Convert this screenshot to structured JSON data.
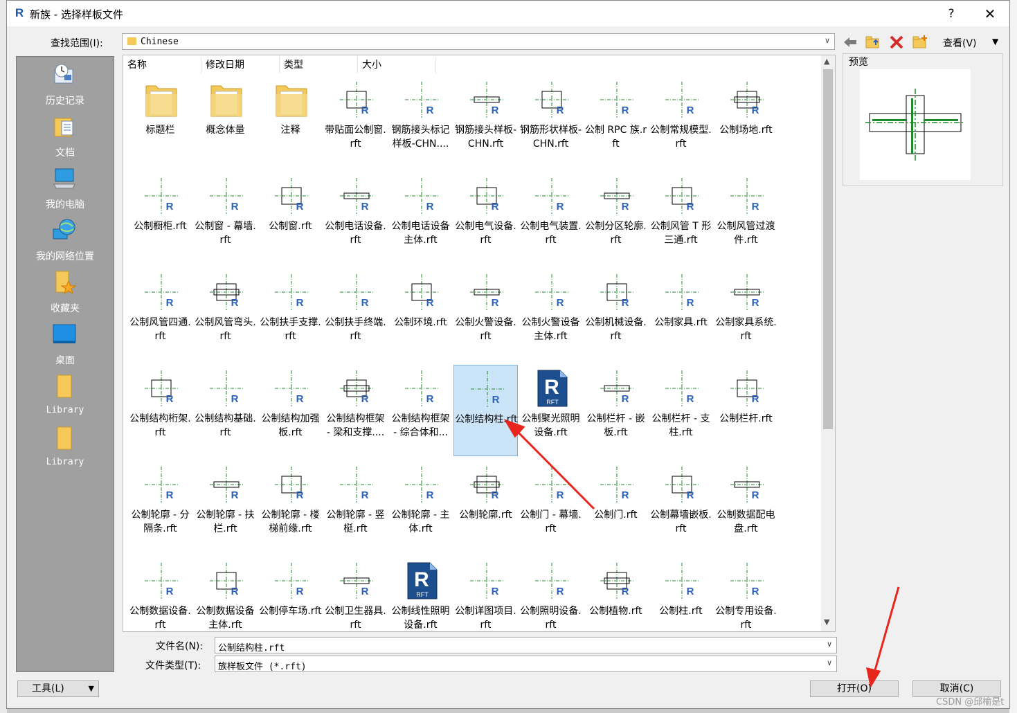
{
  "window": {
    "title": "新族 - 选择样板文件",
    "help": "?",
    "close": "✕"
  },
  "lookin": {
    "label": "查找范围(I):",
    "value": "Chinese"
  },
  "toolbar": {
    "view_label": "查看(V)"
  },
  "places": [
    {
      "label": "历史记录"
    },
    {
      "label": "文档"
    },
    {
      "label": "我的电脑"
    },
    {
      "label": "我的网络位置"
    },
    {
      "label": "收藏夹"
    },
    {
      "label": "桌面"
    },
    {
      "label": "Library"
    },
    {
      "label": "Library"
    }
  ],
  "columns": [
    "名称",
    "修改日期",
    "类型",
    "大小"
  ],
  "items": [
    "标题栏",
    "概念体量",
    "注释",
    "带贴面公制窗.rft",
    "钢筋接头标记样板-CHN....",
    "钢筋接头样板-CHN.rft",
    "钢筋形状样板-CHN.rft",
    "公制 RPC 族.rft",
    "公制常规模型.rft",
    "公制场地.rft",
    "公制橱柜.rft",
    "公制窗 - 幕墙.rft",
    "公制窗.rft",
    "公制电话设备.rft",
    "公制电话设备主体.rft",
    "公制电气设备.rft",
    "公制电气装置.rft",
    "公制分区轮廓.rft",
    "公制风管 T 形三通.rft",
    "公制风管过渡件.rft",
    "公制风管四通.rft",
    "公制风管弯头.rft",
    "公制扶手支撑.rft",
    "公制扶手终端.rft",
    "公制环境.rft",
    "公制火警设备.rft",
    "公制火警设备主体.rft",
    "公制机械设备.rft",
    "公制家具.rft",
    "公制家具系统.rft",
    "公制结构桁架.rft",
    "公制结构基础.rft",
    "公制结构加强板.rft",
    "公制结构框架 - 梁和支撑....",
    "公制结构框架 - 综合体和...",
    "公制结构柱.rft",
    "公制聚光照明设备.rft",
    "公制栏杆 - 嵌板.rft",
    "公制栏杆 - 支柱.rft",
    "公制栏杆.rft",
    "公制轮廓 - 分隔条.rft",
    "公制轮廓 - 扶栏.rft",
    "公制轮廓 - 楼梯前缘.rft",
    "公制轮廓 - 竖梃.rft",
    "公制轮廓 - 主体.rft",
    "公制轮廓.rft",
    "公制门 - 幕墙.rft",
    "公制门.rft",
    "公制幕墙嵌板.rft",
    "公制数据配电盘.rft",
    "公制数据设备.rft",
    "公制数据设备主体.rft",
    "公制停车场.rft",
    "公制卫生器具.rft",
    "公制线性照明设备.rft",
    "公制详图项目.rft",
    "公制照明设备.rft",
    "公制植物.rft",
    "公制柱.rft",
    "公制专用设备.rft"
  ],
  "selected_index": 35,
  "big_rft_badge": "RFT",
  "preview": {
    "label": "预览"
  },
  "filename": {
    "label": "文件名(N):",
    "value": "公制结构柱.rft"
  },
  "filetype": {
    "label": "文件类型(T):",
    "value": "族样板文件 (*.rft)"
  },
  "buttons": {
    "tools": "工具(L)",
    "open": "打开(O)",
    "cancel": "取消(C)"
  },
  "watermark": "CSDN @邱榆是t",
  "colors": {
    "selection": "#cce4f7",
    "arrow": "#e8261c",
    "revit_blue": "#2a62b9",
    "folder": "#f4c95a",
    "cad_green": "#1e8a2a"
  }
}
